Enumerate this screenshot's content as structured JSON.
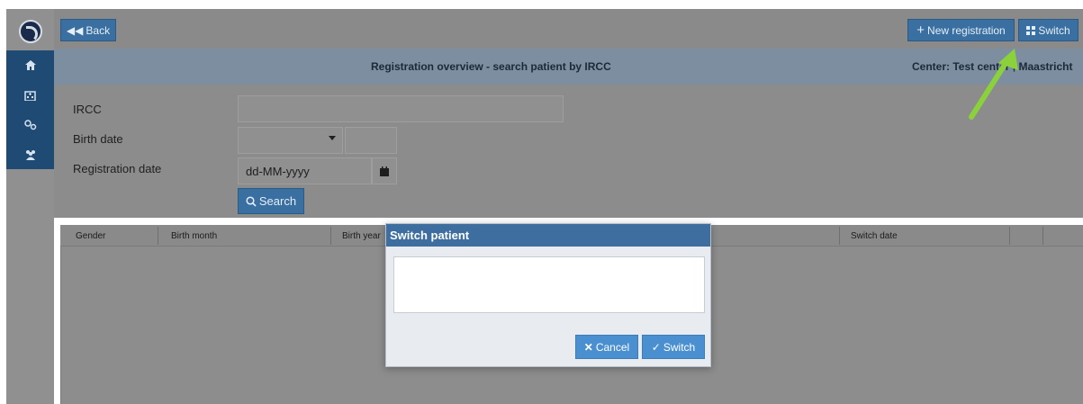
{
  "nav": {
    "back_label": "Back",
    "new_registration_label": "New registration",
    "switch_label": "Switch"
  },
  "header": {
    "title": "Registration overview - search patient by IRCC",
    "center": "Center: Test center , Maastricht"
  },
  "sidebar": {
    "items": [
      {
        "icon": "home-icon"
      },
      {
        "icon": "hospital-icon"
      },
      {
        "icon": "gears-icon"
      },
      {
        "icon": "users-icon"
      }
    ]
  },
  "form": {
    "ircc_label": "IRCC",
    "ircc_value": "",
    "birth_date_label": "Birth date",
    "registration_date_label": "Registration date",
    "registration_date_placeholder": "dd-MM-yyyy",
    "search_label": "Search"
  },
  "table": {
    "columns": [
      "Gender",
      "Birth month",
      "Birth year",
      "Switch date"
    ]
  },
  "modal": {
    "title": "Switch patient",
    "cancel_label": "Cancel",
    "switch_label": "Switch"
  },
  "colors": {
    "primary": "#3a6fa1",
    "modal_header": "#3d6e9f",
    "sidebar_item": "#1e4a73",
    "arrow": "#8bd13b"
  }
}
